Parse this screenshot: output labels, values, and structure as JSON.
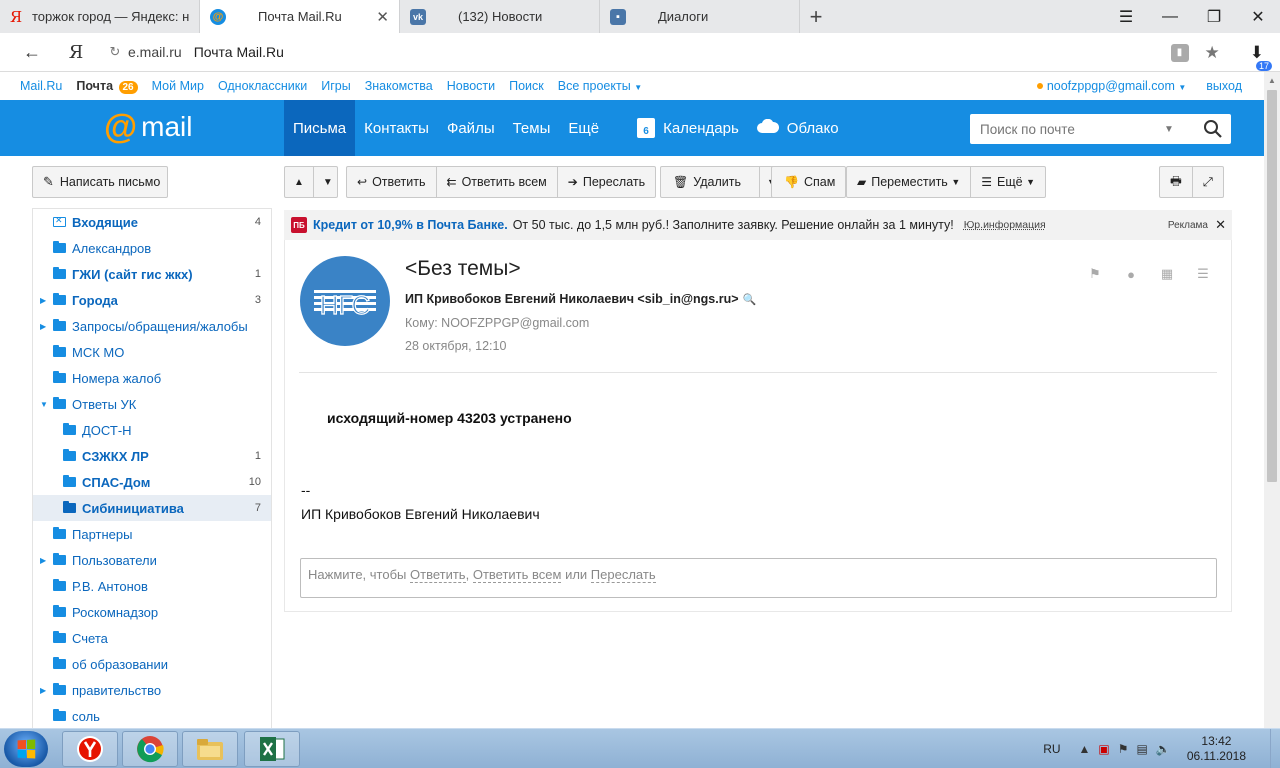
{
  "browser": {
    "tabs": [
      {
        "title": "торжок город — Яндекс: на",
        "favicon": "yandex-icon"
      },
      {
        "title": "Почта Mail.Ru",
        "favicon": "mailru-icon",
        "active": true
      },
      {
        "title": "(132) Новости",
        "favicon": "vk-icon"
      },
      {
        "title": "Диалоги",
        "favicon": "chat-icon"
      }
    ],
    "address": {
      "host": "e.mail.ru",
      "page_title": "Почта Mail.Ru",
      "downloads_count": "17"
    },
    "yandex_letter": "Я"
  },
  "portal": {
    "links": [
      "Mail.Ru",
      "Почта",
      "Мой Мир",
      "Одноклассники",
      "Игры",
      "Знакомства",
      "Новости",
      "Поиск",
      "Все проекты"
    ],
    "mail_count": "26",
    "user_email": "noofzppgp@gmail.com",
    "logout": "выход"
  },
  "header": {
    "logo_word": "mail",
    "nav": [
      "Письма",
      "Контакты",
      "Файлы",
      "Темы",
      "Ещё"
    ],
    "calendar": "Календарь",
    "calendar_day": "6",
    "cloud": "Облако",
    "search_placeholder": "Поиск по почте"
  },
  "sidebar": {
    "compose": "Написать письмо",
    "folders": [
      {
        "name": "Входящие",
        "count": "4"
      },
      {
        "name": "Александров",
        "count": ""
      },
      {
        "name": "ГЖИ (сайт гис жкх)",
        "count": "1"
      },
      {
        "name": "Города",
        "count": "3"
      },
      {
        "name": "Запросы/обращения/жалобы",
        "count": ""
      },
      {
        "name": "МСК МО",
        "count": ""
      },
      {
        "name": "Номера жалоб",
        "count": ""
      },
      {
        "name": "Ответы УК",
        "count": ""
      },
      {
        "name": "ДОСТ-Н",
        "count": ""
      },
      {
        "name": "СЗЖКХ ЛР",
        "count": "1"
      },
      {
        "name": "СПАС-Дом",
        "count": "10"
      },
      {
        "name": "Сибинициатива",
        "count": "7"
      },
      {
        "name": "Партнеры",
        "count": ""
      },
      {
        "name": "Пользователи",
        "count": ""
      },
      {
        "name": "Р.В. Антонов",
        "count": ""
      },
      {
        "name": "Роскомнадзор",
        "count": ""
      },
      {
        "name": "Счета",
        "count": ""
      },
      {
        "name": "об образовании",
        "count": ""
      },
      {
        "name": "правительство",
        "count": ""
      },
      {
        "name": "соль",
        "count": ""
      }
    ]
  },
  "toolbar": {
    "reply": "Ответить",
    "reply_all": "Ответить всем",
    "forward": "Переслать",
    "delete": "Удалить",
    "spam": "Спам",
    "move": "Переместить",
    "more": "Ещё"
  },
  "ad": {
    "badge": "ПБ",
    "title": "Кредит от 10,9% в Почта Банке.",
    "text": "От 50 тыс. до 1,5 млн руб.! Заполните заявку. Решение онлайн за 1 минуту!",
    "legal": "Юр.информация",
    "label": "Реклама"
  },
  "message": {
    "avatar_text": "НГС",
    "subject": "<Без темы>",
    "sender": "ИП Кривобоков Евгений Николаевич <sib_in@ngs.ru>",
    "to": "Кому: NOOFZPPGP@gmail.com",
    "date": "28 октября, 12:10",
    "body": "исходящий-номер 43203 устранено",
    "sig_dash": "--",
    "sig_name": "ИП Кривобоков Евгений Николаевич",
    "quick_reply": {
      "prefix": "Нажмите, чтобы",
      "reply": "Ответить",
      "reply_all": "Ответить всем",
      "or": "или",
      "forward": "Переслать"
    }
  },
  "taskbar": {
    "lang": "RU",
    "time": "13:42",
    "date": "06.11.2018"
  }
}
